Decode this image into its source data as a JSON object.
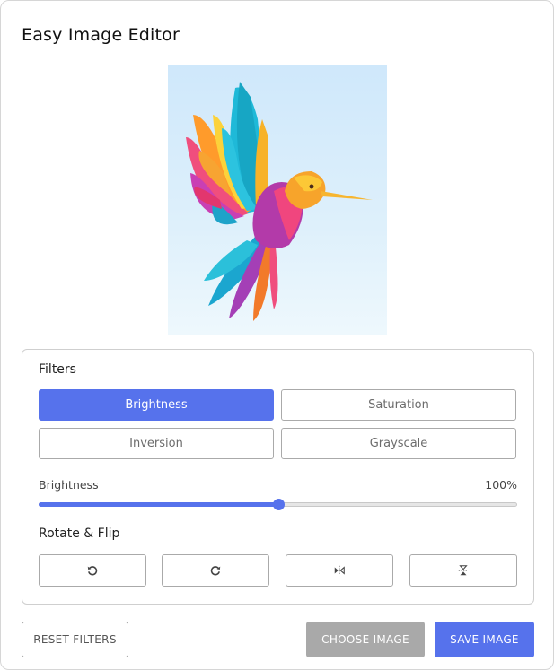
{
  "app": {
    "title": "Easy Image Editor"
  },
  "preview": {
    "image": "hummingbird-illustration"
  },
  "filters": {
    "heading": "Filters",
    "buttons": [
      {
        "label": "Brightness",
        "active": true
      },
      {
        "label": "Saturation",
        "active": false
      },
      {
        "label": "Inversion",
        "active": false
      },
      {
        "label": "Grayscale",
        "active": false
      }
    ]
  },
  "slider": {
    "name": "Brightness",
    "value_text": "100%",
    "value_fraction": 0.5
  },
  "rotate": {
    "heading": "Rotate & Flip",
    "buttons": [
      {
        "icon": "rotate-left-icon"
      },
      {
        "icon": "rotate-right-icon"
      },
      {
        "icon": "flip-horizontal-icon"
      },
      {
        "icon": "flip-vertical-icon"
      }
    ]
  },
  "actions": {
    "reset_label": "RESET FILTERS",
    "choose_label": "CHOOSE IMAGE",
    "save_label": "SAVE IMAGE"
  },
  "colors": {
    "accent": "#5672ec",
    "disabled": "#a9a9a9"
  }
}
